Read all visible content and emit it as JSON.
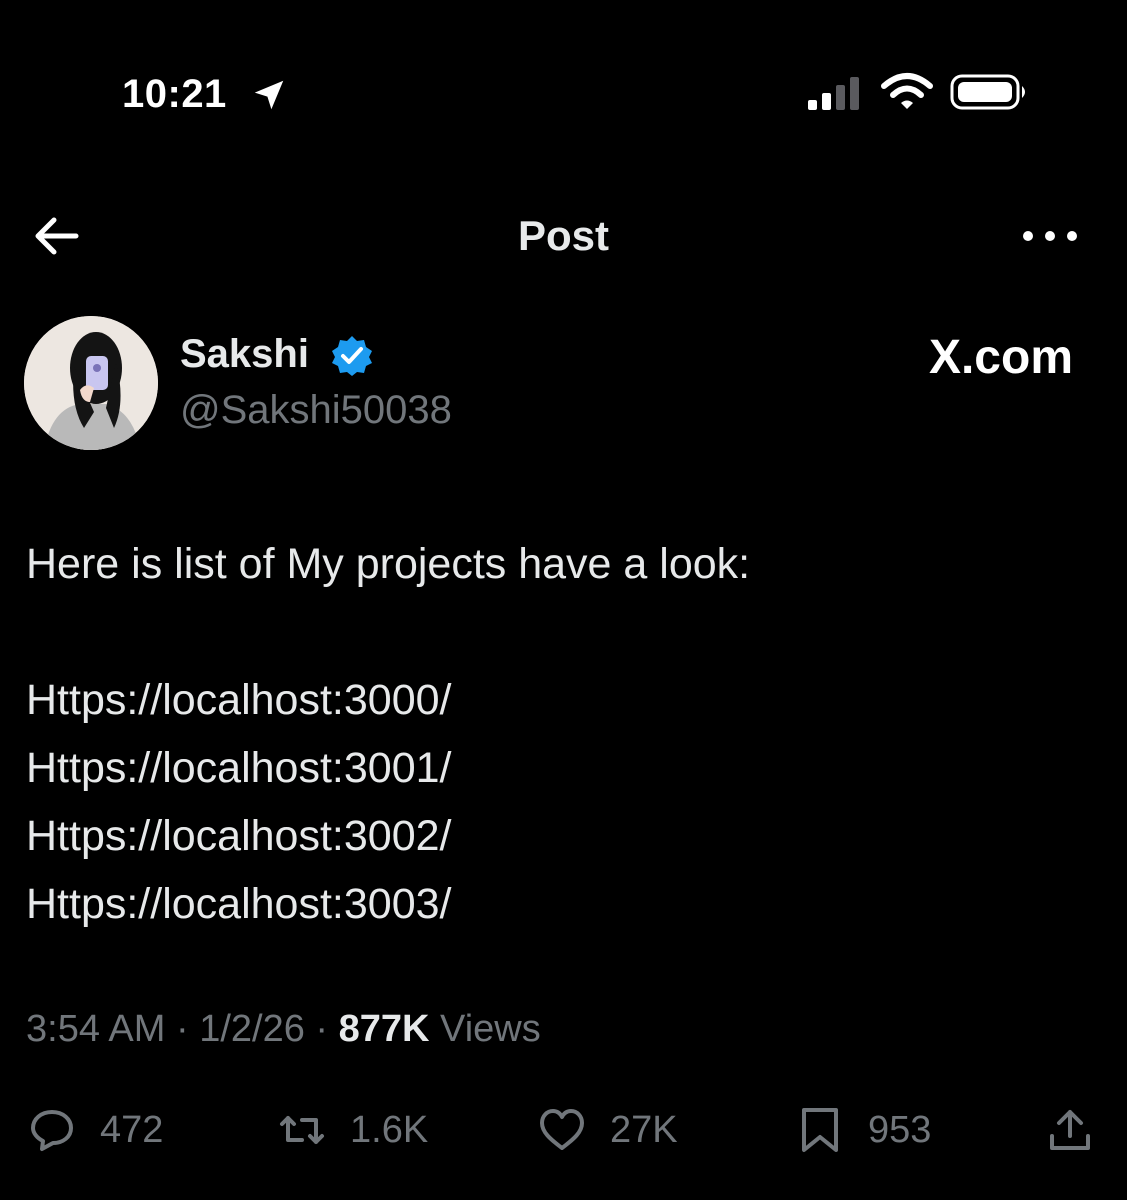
{
  "status_bar": {
    "time": "10:21"
  },
  "header": {
    "title": "Post"
  },
  "author": {
    "name": "Sakshi",
    "handle": "@Sakshi50038",
    "badge": "X.com"
  },
  "tweet": {
    "intro": "Here is list of My projects have a look:",
    "links": [
      "Https://localhost:3000/",
      "Https://localhost:3001/",
      "Https://localhost:3002/",
      "Https://localhost:3003/"
    ]
  },
  "meta": {
    "time": "3:54 AM",
    "separator": " · ",
    "date": "1/2/26",
    "views_count": "877K",
    "views_label": " Views"
  },
  "actions": {
    "replies": "472",
    "reposts": "1.6K",
    "likes": "27K",
    "bookmarks": "953"
  },
  "colors": {
    "background": "#000000",
    "text": "#e7e9ea",
    "muted": "#71767b",
    "verified": "#1d9bf0"
  },
  "icons": [
    "location-arrow-icon",
    "signal-icon",
    "wifi-icon",
    "battery-icon",
    "back-arrow-icon",
    "more-icon",
    "verified-icon",
    "reply-icon",
    "repost-icon",
    "like-icon",
    "bookmark-icon",
    "share-icon"
  ]
}
